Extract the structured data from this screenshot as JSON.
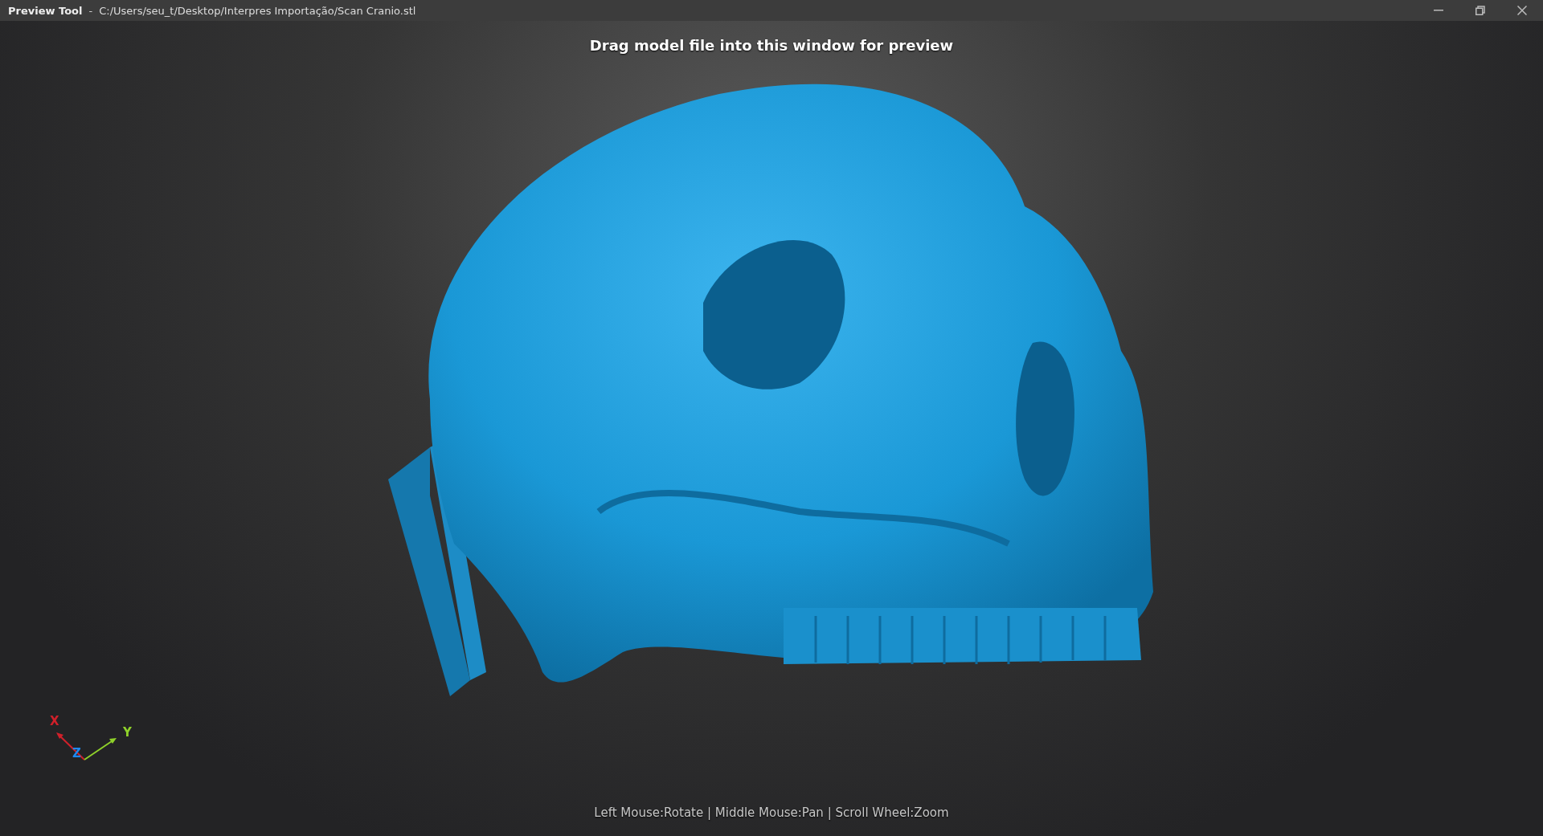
{
  "window": {
    "app_name": "Preview Tool",
    "separator": "-",
    "file_path": "C:/Users/seu_t/Desktop/Interpres Importação/Scan Cranio.stl"
  },
  "viewport": {
    "top_hint": "Drag model file into this window for preview",
    "controls_hint": "Left Mouse:Rotate | Middle Mouse:Pan | Scroll Wheel:Zoom"
  },
  "axes": [
    {
      "label": "X",
      "color": "#d0202a"
    },
    {
      "label": "Y",
      "color": "#8fd12a"
    },
    {
      "label": "Z",
      "color": "#1e88f0"
    }
  ]
}
